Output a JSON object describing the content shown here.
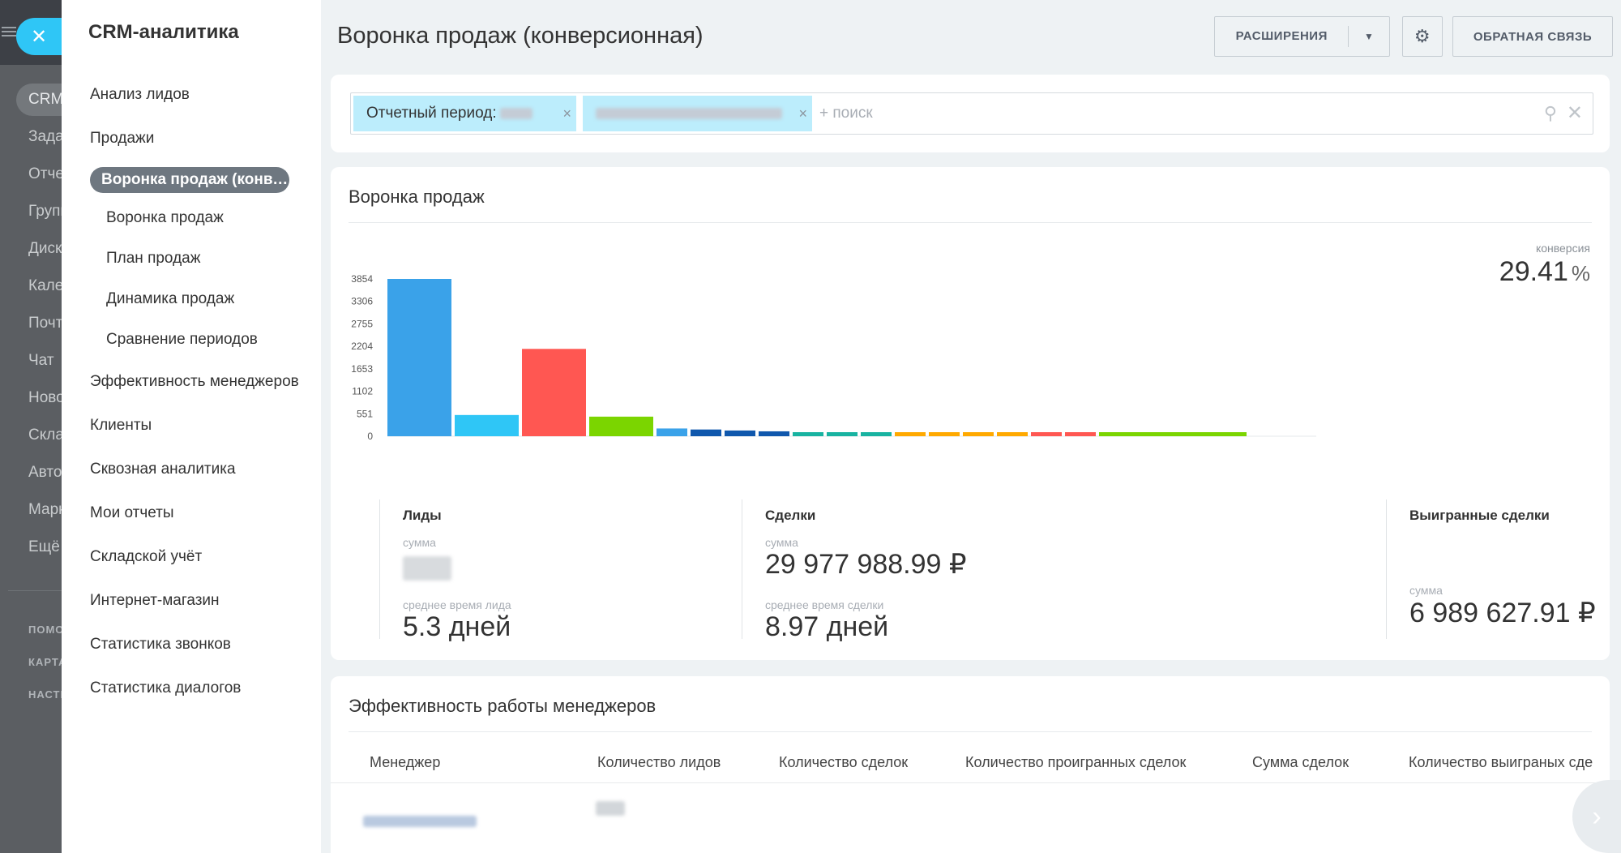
{
  "background_app": {
    "items": [
      "CRM",
      "Задачи",
      "Отчеты",
      "Группы",
      "Диск",
      "Календарь",
      "Почта",
      "Чат",
      "Новости",
      "Склад",
      "Автоматизация",
      "Маркет",
      "Ещё"
    ],
    "bottom_items": [
      "ПОМОЩЬ",
      "КАРТА",
      "НАСТРОЙКИ"
    ]
  },
  "left_menu": {
    "title": "CRM-аналитика",
    "items": [
      {
        "label": "Анализ лидов"
      },
      {
        "label": "Продажи"
      },
      {
        "label": "Воронка продаж (конверсионная)"
      },
      {
        "label": "Воронка продаж"
      },
      {
        "label": "План продаж"
      },
      {
        "label": "Динамика продаж"
      },
      {
        "label": "Сравнение периодов"
      },
      {
        "label": "Эффективность менеджеров"
      },
      {
        "label": "Клиенты"
      },
      {
        "label": "Сквозная аналитика"
      },
      {
        "label": "Мои отчеты"
      },
      {
        "label": "Складской учёт"
      },
      {
        "label": "Интернет-магазин"
      },
      {
        "label": "Статистика звонков"
      },
      {
        "label": "Статистика диалогов"
      }
    ]
  },
  "header": {
    "title": "Воронка продаж (конверсионная)",
    "extensions_label": "РАСШИРЕНИЯ",
    "feedback_label": "ОБРАТНАЯ СВЯЗЬ"
  },
  "filter": {
    "chip1_label": "Отчетный период:",
    "search_placeholder": "+ поиск"
  },
  "funnel": {
    "title": "Воронка продаж",
    "conversion_label": "конверсия",
    "conversion_value": "29.41",
    "conversion_unit": "%",
    "stats": {
      "leads": {
        "title": "Лиды",
        "sum_label": "сумма",
        "time_label": "среднее время лида",
        "time_value": "5.3 дней"
      },
      "deals": {
        "title": "Сделки",
        "sum_label": "сумма",
        "sum_value": "29 977 988.99 ₽",
        "time_label": "среднее время сделки",
        "time_value": "8.97 дней"
      },
      "won": {
        "title": "Выигранные сделки",
        "sum_label": "сумма",
        "sum_value": "6 989 627.91 ₽"
      }
    }
  },
  "chart_data": {
    "type": "bar",
    "ylim": [
      0,
      3854
    ],
    "yticks": [
      0,
      551,
      1102,
      1653,
      2204,
      2755,
      3306,
      3854
    ],
    "series": [
      {
        "values": [
          3854,
          520,
          0,
          0,
          0,
          0,
          0,
          0,
          0,
          0,
          0,
          0,
          0,
          0,
          0,
          0,
          0,
          0
        ],
        "color": "#3aa2e9"
      },
      {
        "values": [
          0,
          0,
          2140,
          480,
          0,
          0,
          0,
          0,
          0,
          0,
          0,
          0,
          0,
          0,
          0,
          0,
          0,
          0
        ],
        "color": "#ff5752"
      }
    ],
    "segments": [
      {
        "value": 3854,
        "color": "#3aa2e9",
        "width": 83
      },
      {
        "value": 520,
        "color": "#2fc6f6",
        "width": 83
      },
      {
        "value": 2140,
        "color": "#ff5752",
        "width": 83
      },
      {
        "value": 480,
        "color": "#7bd500",
        "width": 83
      },
      {
        "value": 190,
        "color": "#3aa2e9",
        "width": 42
      },
      {
        "value": 165,
        "color": "#1058ad",
        "width": 42
      },
      {
        "value": 140,
        "color": "#1058ad",
        "width": 42
      },
      {
        "value": 120,
        "color": "#1058ad",
        "width": 42
      },
      {
        "value": 95,
        "color": "#18b3a1",
        "width": 42
      },
      {
        "value": 90,
        "color": "#18b3a1",
        "width": 42
      },
      {
        "value": 85,
        "color": "#18b3a1",
        "width": 42
      },
      {
        "value": 80,
        "color": "#ffa900",
        "width": 42
      },
      {
        "value": 80,
        "color": "#ffa900",
        "width": 42
      },
      {
        "value": 80,
        "color": "#ffa900",
        "width": 42
      },
      {
        "value": 80,
        "color": "#ffa900",
        "width": 42
      },
      {
        "value": 95,
        "color": "#ff5752",
        "width": 42
      },
      {
        "value": 45,
        "color": "#ff5752",
        "width": 42
      },
      {
        "value": 75,
        "color": "#7bd500",
        "width": 186
      }
    ]
  },
  "managers": {
    "title": "Эффективность работы менеджеров",
    "columns": [
      "Менеджер",
      "Количество лидов",
      "Количество сделок",
      "Количество проигранных сделок",
      "Сумма сделок",
      "Количество выиграных сде"
    ]
  }
}
